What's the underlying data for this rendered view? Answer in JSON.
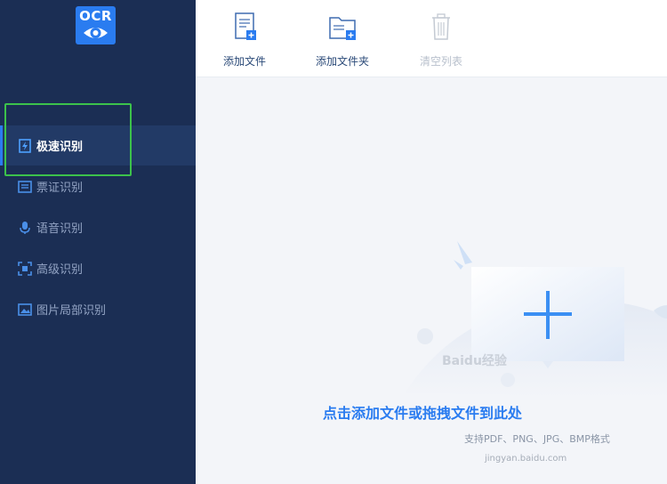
{
  "logo": {
    "text": "OCR"
  },
  "sidebar": {
    "items": [
      {
        "label": "极速识别",
        "icon": "lightning-doc-icon",
        "active": true
      },
      {
        "label": "票证识别",
        "icon": "ticket-icon",
        "active": false
      },
      {
        "label": "语音识别",
        "icon": "microphone-icon",
        "active": false
      },
      {
        "label": "高级识别",
        "icon": "scan-bracket-icon",
        "active": false
      },
      {
        "label": "图片局部识别",
        "icon": "image-crop-icon",
        "active": false
      }
    ]
  },
  "toolbar": {
    "add_file": "添加文件",
    "add_folder": "添加文件夹",
    "clear_list": "清空列表"
  },
  "drop_zone": {
    "title": "点击添加文件或拖拽文件到此处",
    "subtitle": "支持PDF、PNG、JPG、BMP格式"
  },
  "watermark": {
    "main": "Baidu经验",
    "url": "jingyan.baidu.com"
  },
  "colors": {
    "sidebar_bg": "#1b2e54",
    "accent": "#2a7cf0",
    "highlight": "#3cc24b",
    "content_bg": "#f3f5f9"
  }
}
